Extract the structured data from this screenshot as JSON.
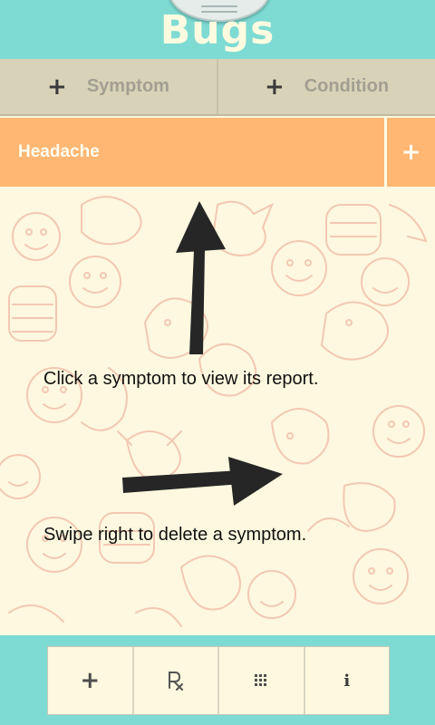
{
  "app": {
    "title": "Bugs"
  },
  "tabs": [
    {
      "plus": "+",
      "label": "Symptom"
    },
    {
      "plus": "+",
      "label": "Condition"
    }
  ],
  "symptoms": [
    {
      "name": "Headache",
      "add": "+"
    }
  ],
  "hints": {
    "view": "Click a symptom to view its report.",
    "delete": "Swipe right to delete a symptom."
  },
  "footer": {
    "add": "+",
    "rx_icon": "prescription-icon",
    "grid_icon": "grid-icon",
    "info": "i"
  },
  "colors": {
    "header": "#7ddbd3",
    "tab_bar": "#d8d3b8",
    "symptom_row": "#ffb773",
    "background": "#fdf8df",
    "doodle": "#f0b9a3"
  }
}
